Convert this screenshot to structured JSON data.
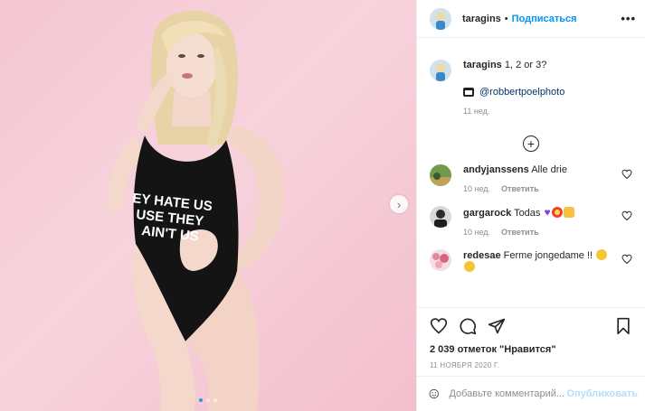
{
  "post": {
    "shirt_text": [
      "EY HATE US",
      "USE THEY",
      "AIN'T US"
    ],
    "carousel": {
      "count": 3,
      "active": 0
    }
  },
  "header": {
    "username": "taragins",
    "separator": "•",
    "follow_label": "Подписаться",
    "more_label": "•••"
  },
  "caption": {
    "username": "taragins",
    "text": "1, 2 or 3?",
    "credit": "@robbertpoelphoto",
    "time": "11 нед."
  },
  "comments": [
    {
      "username": "andyjanssens",
      "text": "Alle drie",
      "emoji": [],
      "time": "10 нед.",
      "reply": "Ответить"
    },
    {
      "username": "gargarock",
      "text": "Todas",
      "emoji": [
        "purple-heart",
        "collision",
        "raising-hands"
      ],
      "time": "10 нед.",
      "reply": "Ответить"
    },
    {
      "username": "redesae",
      "text": "Ferme jongedame !!",
      "emoji": [
        "grinning-face",
        "grinning-face"
      ],
      "time": "",
      "reply": ""
    }
  ],
  "actions": {
    "likes": "2 039 отметок \"Нравится\"",
    "date": "11 НОЯБРЯ 2020 Г."
  },
  "comment_form": {
    "placeholder": "Добавьте комментарий...",
    "publish_label": "Опубликовать"
  },
  "colors": {
    "accent": "#0095f6",
    "publish_disabled": "#b2dffc",
    "muted": "#8e8e8e",
    "background_photo": "#f4c7d3"
  }
}
